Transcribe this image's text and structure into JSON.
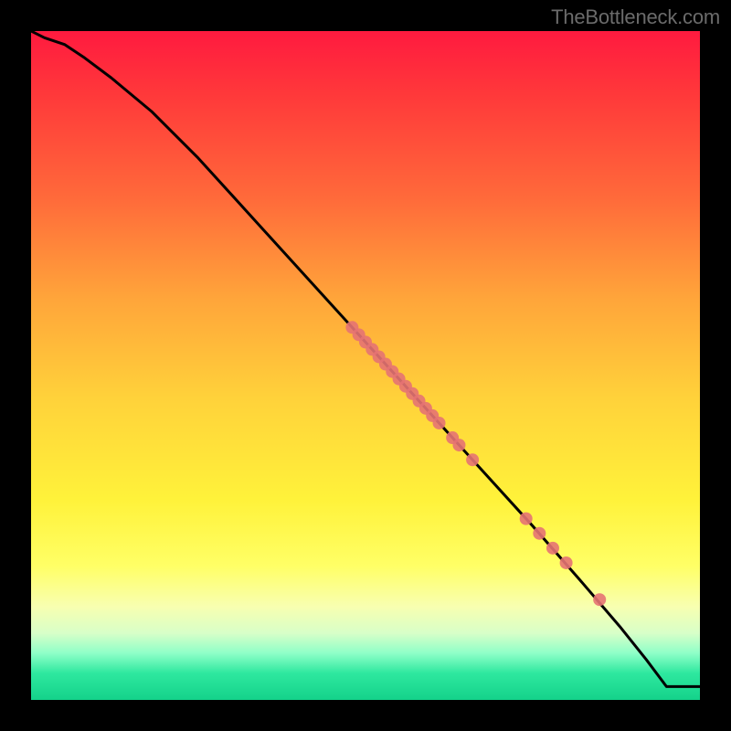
{
  "watermark": "TheBottleneck.com",
  "chart_data": {
    "type": "line",
    "title": "",
    "xlabel": "",
    "ylabel": "",
    "xlim": [
      0,
      100
    ],
    "ylim": [
      0,
      100
    ],
    "grid": false,
    "series": [
      {
        "name": "curve",
        "type": "line",
        "color": "#000000",
        "x": [
          0,
          2,
          5,
          8,
          12,
          18,
          25,
          35,
          45,
          55,
          65,
          75,
          82,
          88,
          92,
          95,
          100
        ],
        "y": [
          100,
          99,
          98,
          96,
          93,
          88,
          81,
          70,
          59,
          48,
          37,
          26,
          18,
          11,
          6,
          2,
          2
        ]
      },
      {
        "name": "dots",
        "type": "scatter",
        "color": "#e57373",
        "x": [
          48,
          49,
          50,
          51,
          52,
          53,
          54,
          55,
          56,
          57,
          58,
          59,
          60,
          61,
          63,
          64,
          66,
          74,
          76,
          78,
          80,
          85
        ],
        "y": [
          55.7,
          54.6,
          53.5,
          52.4,
          51.3,
          50.2,
          49.1,
          48.0,
          46.9,
          45.8,
          44.7,
          43.6,
          42.5,
          41.4,
          39.2,
          38.1,
          35.9,
          27.1,
          24.9,
          22.7,
          20.5,
          15.0
        ]
      }
    ]
  }
}
